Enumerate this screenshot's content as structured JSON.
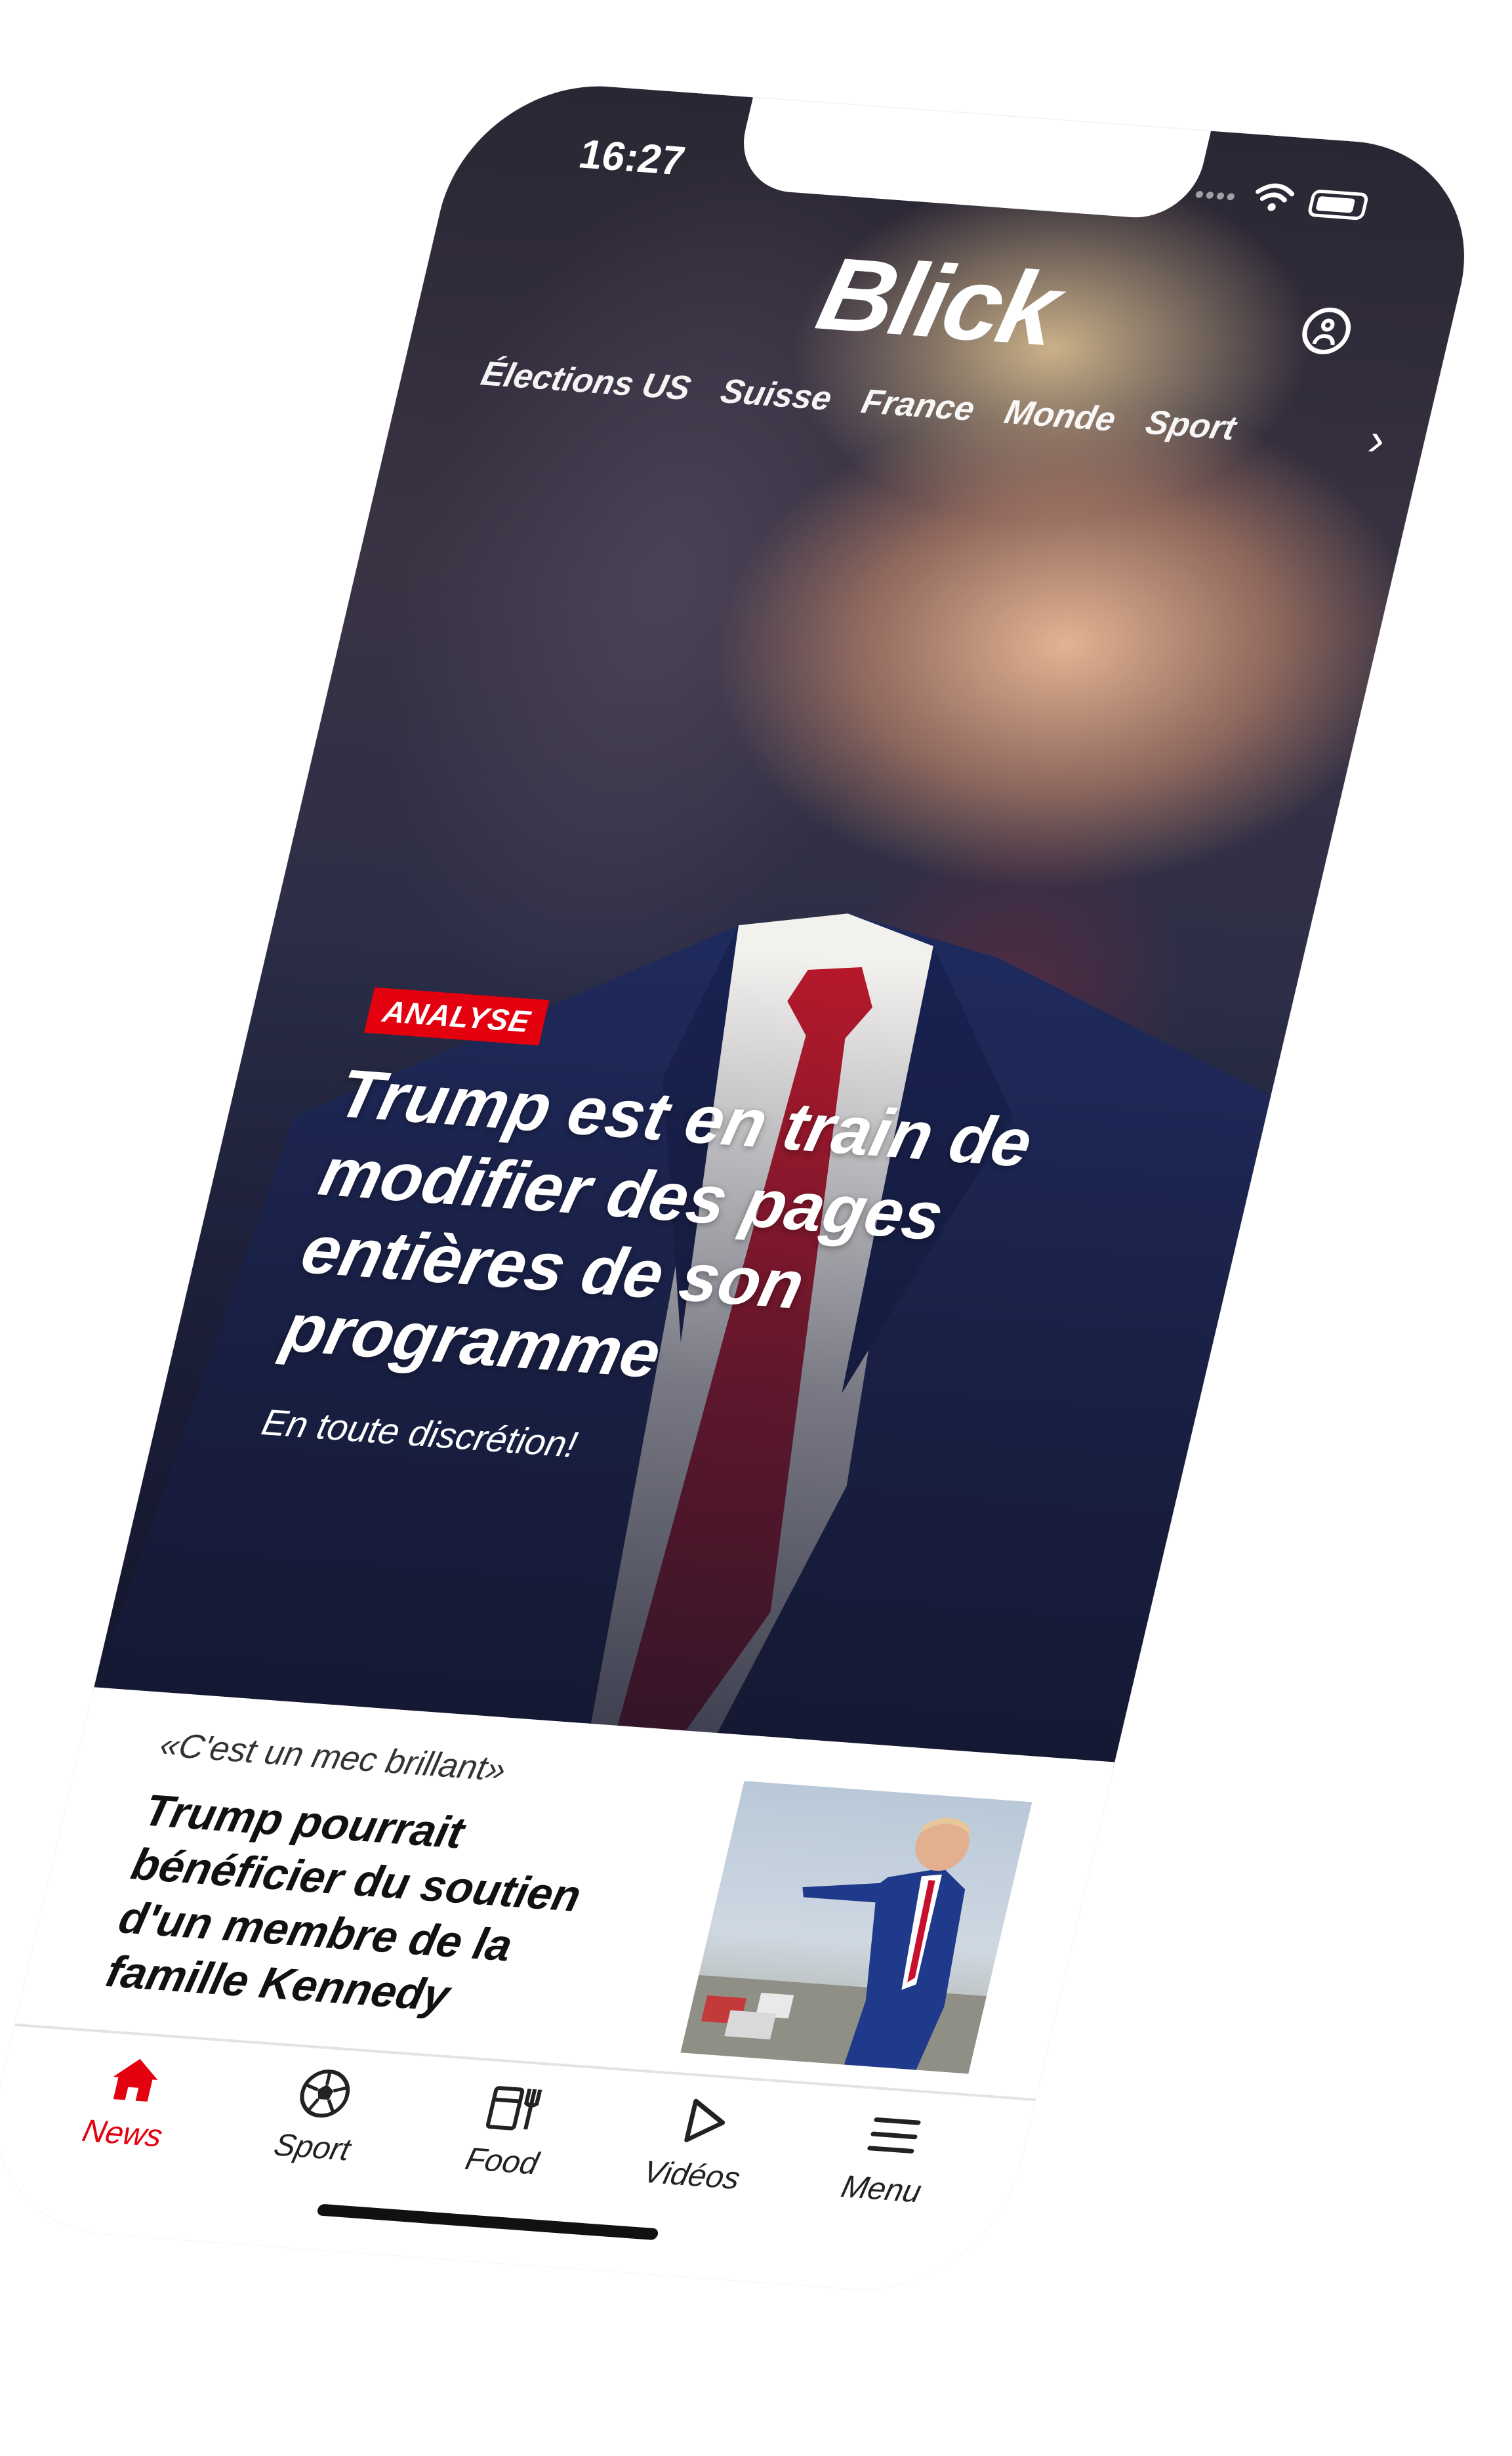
{
  "status_bar": {
    "time": "16:27"
  },
  "header": {
    "logo": "Blick"
  },
  "nav": {
    "items": [
      "Élections US",
      "Suisse",
      "France",
      "Monde",
      "Sport"
    ],
    "more_glyph": "›"
  },
  "hero": {
    "badge": "ANALYSE",
    "headline": "Trump est en train de modifier des pages entières de son programme",
    "subline": "En toute discrétion!"
  },
  "article_card": {
    "kicker": "«C'est un mec brillant»",
    "title": "Trump pourrait bénéficier du soutien d'un membre de la famille Kennedy"
  },
  "tabbar": {
    "items": [
      {
        "label": "News",
        "icon": "home-icon",
        "active": true
      },
      {
        "label": "Sport",
        "icon": "soccer-ball-icon",
        "active": false
      },
      {
        "label": "Food",
        "icon": "food-icon",
        "active": false
      },
      {
        "label": "Vidéos",
        "icon": "play-icon",
        "active": false
      },
      {
        "label": "Menu",
        "icon": "menu-icon",
        "active": false
      }
    ]
  },
  "colors": {
    "accent": "#e3000f",
    "text_dark": "#111111",
    "white": "#ffffff"
  }
}
